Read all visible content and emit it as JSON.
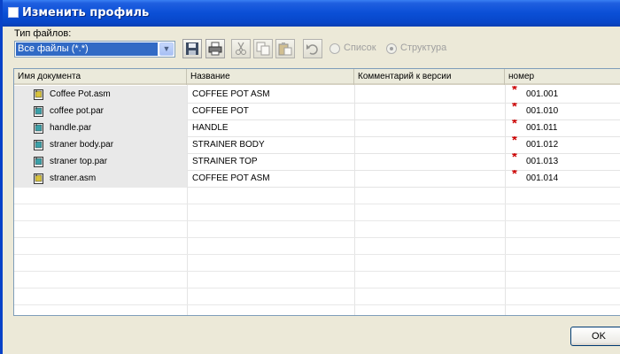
{
  "window": {
    "title": "Изменить профиль"
  },
  "toolbar": {
    "filetype_label": "Тип файлов:",
    "filetype_value": "Все файлы (*.*)",
    "buttons": [
      "save-icon",
      "print-icon",
      "cut-icon",
      "copy-icon",
      "paste-icon",
      "undo-icon"
    ],
    "radio_list": "Список",
    "radio_structure": "Структура",
    "selected_view": "Структура"
  },
  "grid": {
    "columns": [
      "Имя документа",
      "Название",
      "Комментарий к версии",
      "номер"
    ],
    "rows": [
      {
        "name": "Coffee Pot.asm",
        "title": "COFFEE POT ASM",
        "comment": "",
        "number": "001.001",
        "type": "assembly",
        "required": "*"
      },
      {
        "name": "coffee pot.par",
        "title": "COFFEE POT",
        "comment": "",
        "number": "001.010",
        "type": "part",
        "required": "*"
      },
      {
        "name": "handle.par",
        "title": "HANDLE",
        "comment": "",
        "number": "001.011",
        "type": "part",
        "required": "*"
      },
      {
        "name": "straner body.par",
        "title": "STRAINER BODY",
        "comment": "",
        "number": "001.012",
        "type": "part",
        "required": "*"
      },
      {
        "name": "straner top.par",
        "title": "STRAINER TOP",
        "comment": "",
        "number": "001.013",
        "type": "part",
        "required": "*"
      },
      {
        "name": "straner.asm",
        "title": "COFFEE POT ASM",
        "comment": "",
        "number": "001.014",
        "type": "assembly",
        "required": "*"
      }
    ]
  },
  "footer": {
    "ok_label": "OK"
  },
  "colors": {
    "titlebar": "#0a4fd6",
    "selection": "#316ac5",
    "required_star": "#cc0000",
    "dialog_bg": "#ece9d8"
  }
}
